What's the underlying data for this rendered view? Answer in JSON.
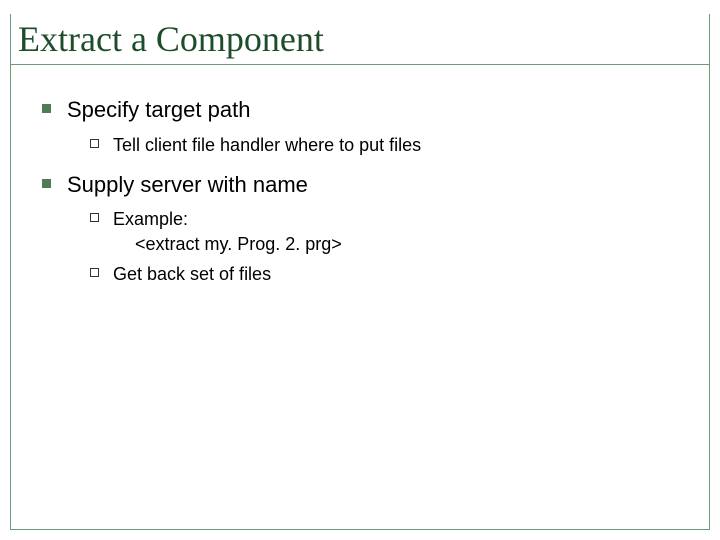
{
  "title": "Extract a Component",
  "bullets": {
    "item1": "Specify target path",
    "item1_sub1": "Tell client file handler where to put files",
    "item2": "Supply server with name",
    "item2_sub1_line1": "Example:",
    "item2_sub1_line2": "<extract my. Prog. 2. prg>",
    "item2_sub2": "Get back set of files"
  }
}
